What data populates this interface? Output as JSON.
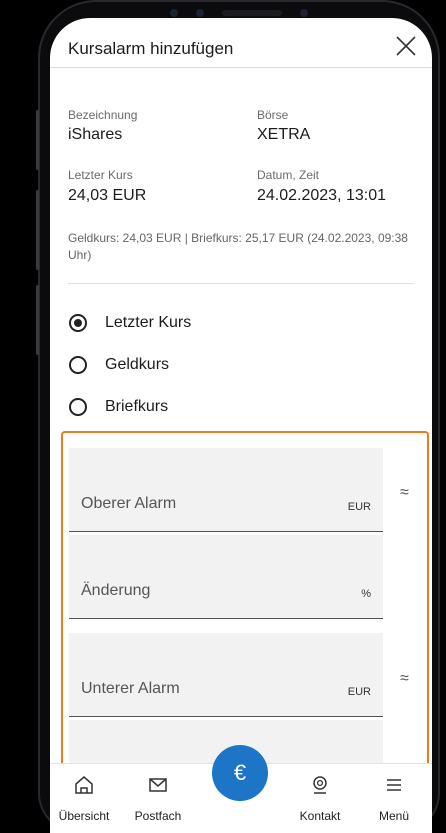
{
  "header": {
    "title": "Kursalarm hinzufügen"
  },
  "info": {
    "bezeichnung_label": "Bezeichnung",
    "bezeichnung_value": "iShares",
    "boerse_label": "Börse",
    "boerse_value": "XETRA",
    "letzter_kurs_label": "Letzter Kurs",
    "letzter_kurs_value": "24,03 EUR",
    "datum_label": "Datum, Zeit",
    "datum_value": "24.02.2023, 13:01",
    "note": "Geldkurs: 24,03 EUR | Briefkurs: 25,17 EUR (24.02.2023, 09:38 Uhr)"
  },
  "price_type": {
    "options": [
      "Letzter Kurs",
      "Geldkurs",
      "Briefkurs"
    ],
    "selected": "Letzter Kurs"
  },
  "alarm_fields": {
    "oberer_alarm": {
      "label": "Oberer Alarm",
      "unit": "EUR"
    },
    "aenderung": {
      "label": "Änderung",
      "unit": "%"
    },
    "unterer_alarm": {
      "label": "Unterer Alarm",
      "unit": "EUR"
    },
    "approx_symbol": "≈"
  },
  "bottom_nav": {
    "items": [
      "Übersicht",
      "Postfach",
      "Kontakt",
      "Menü"
    ],
    "center_symbol": "€"
  },
  "colors": {
    "accent": "#1d75c7",
    "highlight": "#f07a1c"
  }
}
